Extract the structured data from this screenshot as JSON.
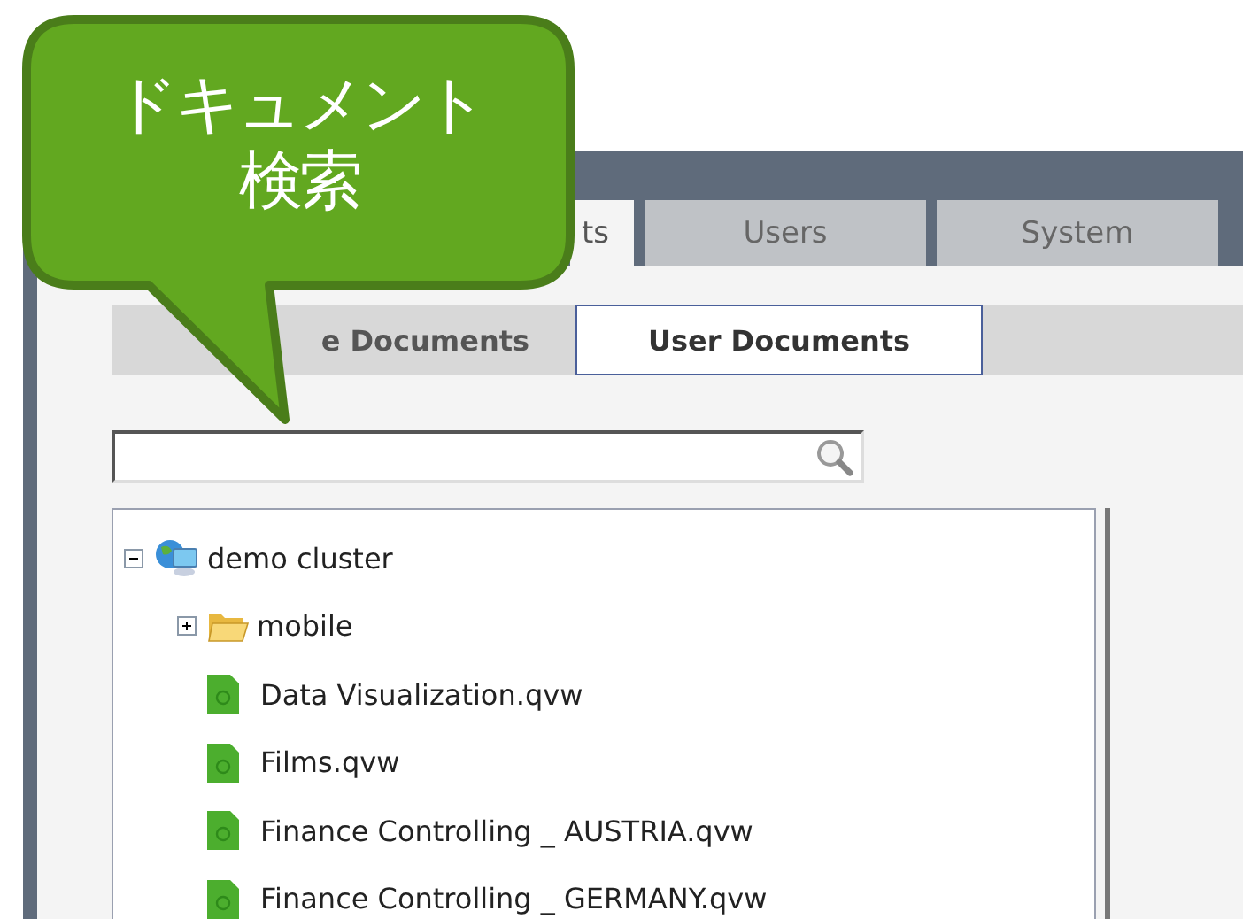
{
  "callout": {
    "lines": [
      "ドキュメント",
      "検索"
    ]
  },
  "tabs": [
    {
      "label": "ts",
      "selected": true
    },
    {
      "label": "Users",
      "selected": false
    },
    {
      "label": "System",
      "selected": false
    }
  ],
  "sub_tabs": [
    {
      "label": "e Documents",
      "selected": false
    },
    {
      "label": "User Documents",
      "selected": true
    }
  ],
  "tree": [
    {
      "label": "demo cluster",
      "kind": "cluster",
      "expanded": true,
      "children": [
        {
          "label": "mobile",
          "kind": "folder",
          "expanded": false
        },
        {
          "label": "Data Visualization.qvw",
          "kind": "document"
        },
        {
          "label": "Films.qvw",
          "kind": "document"
        },
        {
          "label": "Finance Controlling _ AUSTRIA.qvw",
          "kind": "document"
        },
        {
          "label": "Finance Controlling _ GERMANY.qvw",
          "kind": "document"
        }
      ]
    }
  ]
}
